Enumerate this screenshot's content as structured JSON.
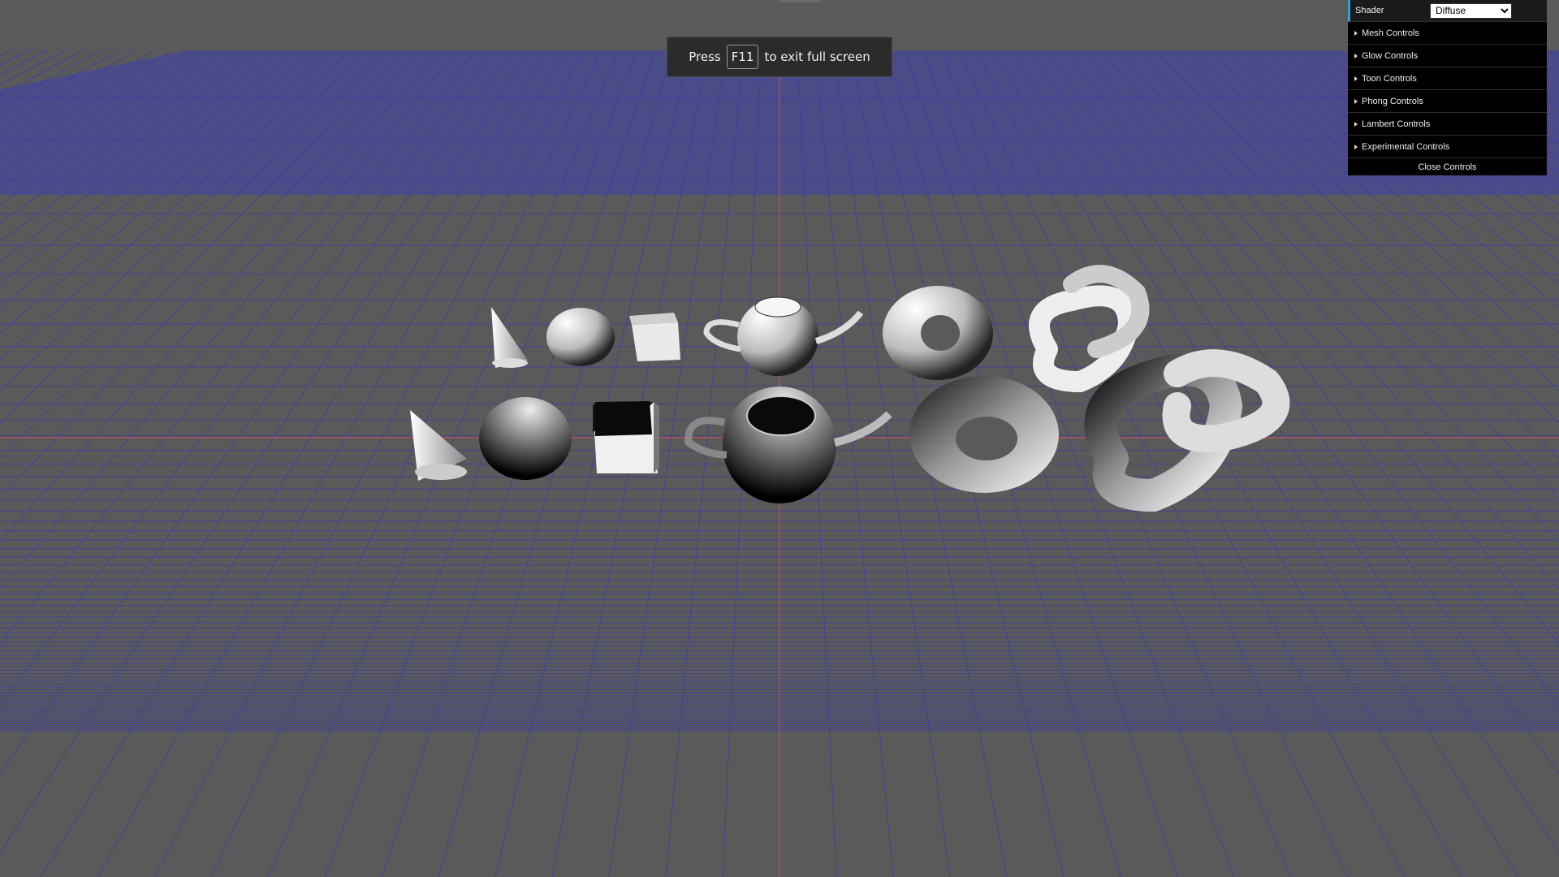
{
  "toast": {
    "before": "Press",
    "key": "F11",
    "after": "to exit full screen"
  },
  "gui": {
    "shader_label": "Shader",
    "shader_options": [
      "Diffuse"
    ],
    "shader_value": "Diffuse",
    "folders": [
      "Mesh Controls",
      "Glow Controls",
      "Toon Controls",
      "Phong Controls",
      "Lambert Controls",
      "Experimental Controls"
    ],
    "close_label": "Close Controls"
  },
  "scene": {
    "background": "#5a5a5a",
    "sky": "#4a4a8a",
    "grid_color": "#3c3cb4",
    "axis_color": "#e04040",
    "objects_top": [
      "cone-icon",
      "sphere-icon",
      "cube-icon",
      "teapot-icon",
      "torus-icon",
      "torus-knot-icon"
    ],
    "objects_bottom": [
      "cone-icon",
      "sphere-icon",
      "cube-icon",
      "teapot-icon",
      "torus-icon",
      "torus-knot-icon"
    ]
  }
}
